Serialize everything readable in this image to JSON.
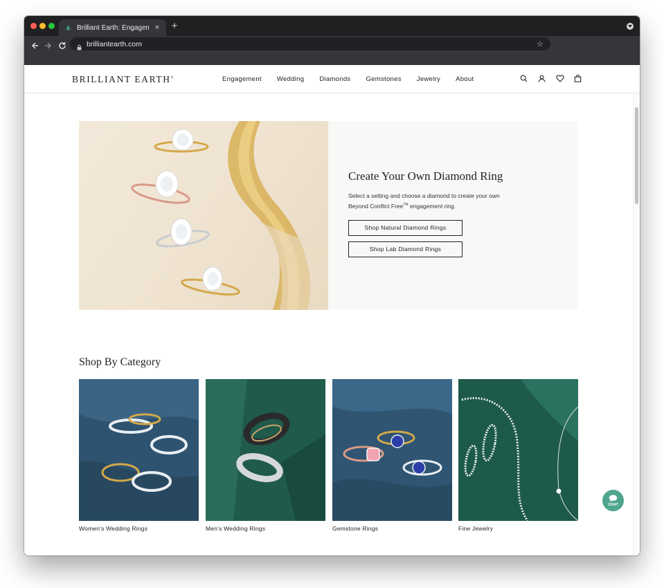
{
  "browser": {
    "tab_title": "Brilliant Earth: Engagement Rings",
    "tab_close": "×",
    "new_tab": "+",
    "url": "brilliantearth.com"
  },
  "site": {
    "logo": "BRILLIANT EARTH",
    "logo_mark": "®",
    "nav": [
      "Engagement",
      "Wedding",
      "Diamonds",
      "Gemstones",
      "Jewelry",
      "About"
    ],
    "icons": [
      "search-icon",
      "account-icon",
      "heart-icon",
      "bag-icon"
    ]
  },
  "hero": {
    "title": "Create Your Own Diamond Ring",
    "desc_line1": "Select a setting and choose a diamond to create your own",
    "desc_line2_prefix": "Beyond Conflict Free",
    "desc_tm": "TM",
    "desc_line2_suffix": " engagement ring.",
    "btn_natural": "Shop Natural Diamond Rings",
    "btn_lab": "Shop Lab Diamond Rings"
  },
  "category": {
    "title": "Shop By Category",
    "items": [
      {
        "label": "Women’s Wedding Rings"
      },
      {
        "label": "Men’s Wedding Rings"
      },
      {
        "label": "Gemstone Rings"
      },
      {
        "label": "Fine Jewelry"
      }
    ]
  },
  "chat": {
    "label": "CHAT"
  },
  "colors": {
    "accent": "#4fa58e",
    "chrome_dark": "#1f2022",
    "chrome_toolbar": "#35363a"
  }
}
